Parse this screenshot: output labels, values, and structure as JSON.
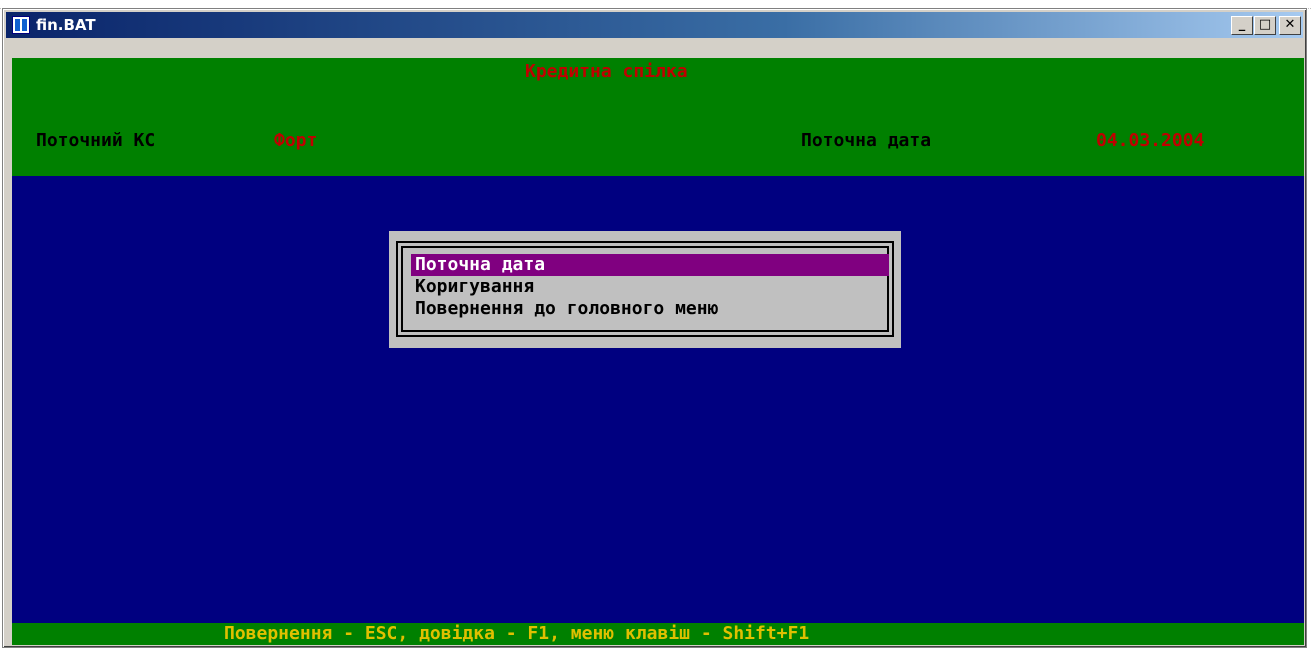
{
  "window": {
    "title": "fin.BAT",
    "icon": "console-app-icon",
    "buttons": {
      "minimize": "_",
      "maximize": "□",
      "close": "✕"
    }
  },
  "header": {
    "app_title": "Кредитна спілка",
    "current_cu_label": "Поточний КС",
    "current_cu_value": "Форт",
    "current_date_label": "Поточна дата",
    "current_date_value": "04.03.2004"
  },
  "menu": {
    "items": [
      {
        "label": "Поточна дата",
        "selected": true
      },
      {
        "label": "Коригування",
        "selected": false
      },
      {
        "label": "Повернення до головного меню",
        "selected": false
      }
    ]
  },
  "status_bar": {
    "text": "Повернення - ESC, довідка - F1, меню клавіш - Shift+F1"
  },
  "colors": {
    "console_bg": "#000080",
    "header_bg": "#008000",
    "title_red": "#c00000",
    "menu_bg": "#c0c0c0",
    "menu_selected_bg": "#800080",
    "status_text": "#e0c000"
  }
}
